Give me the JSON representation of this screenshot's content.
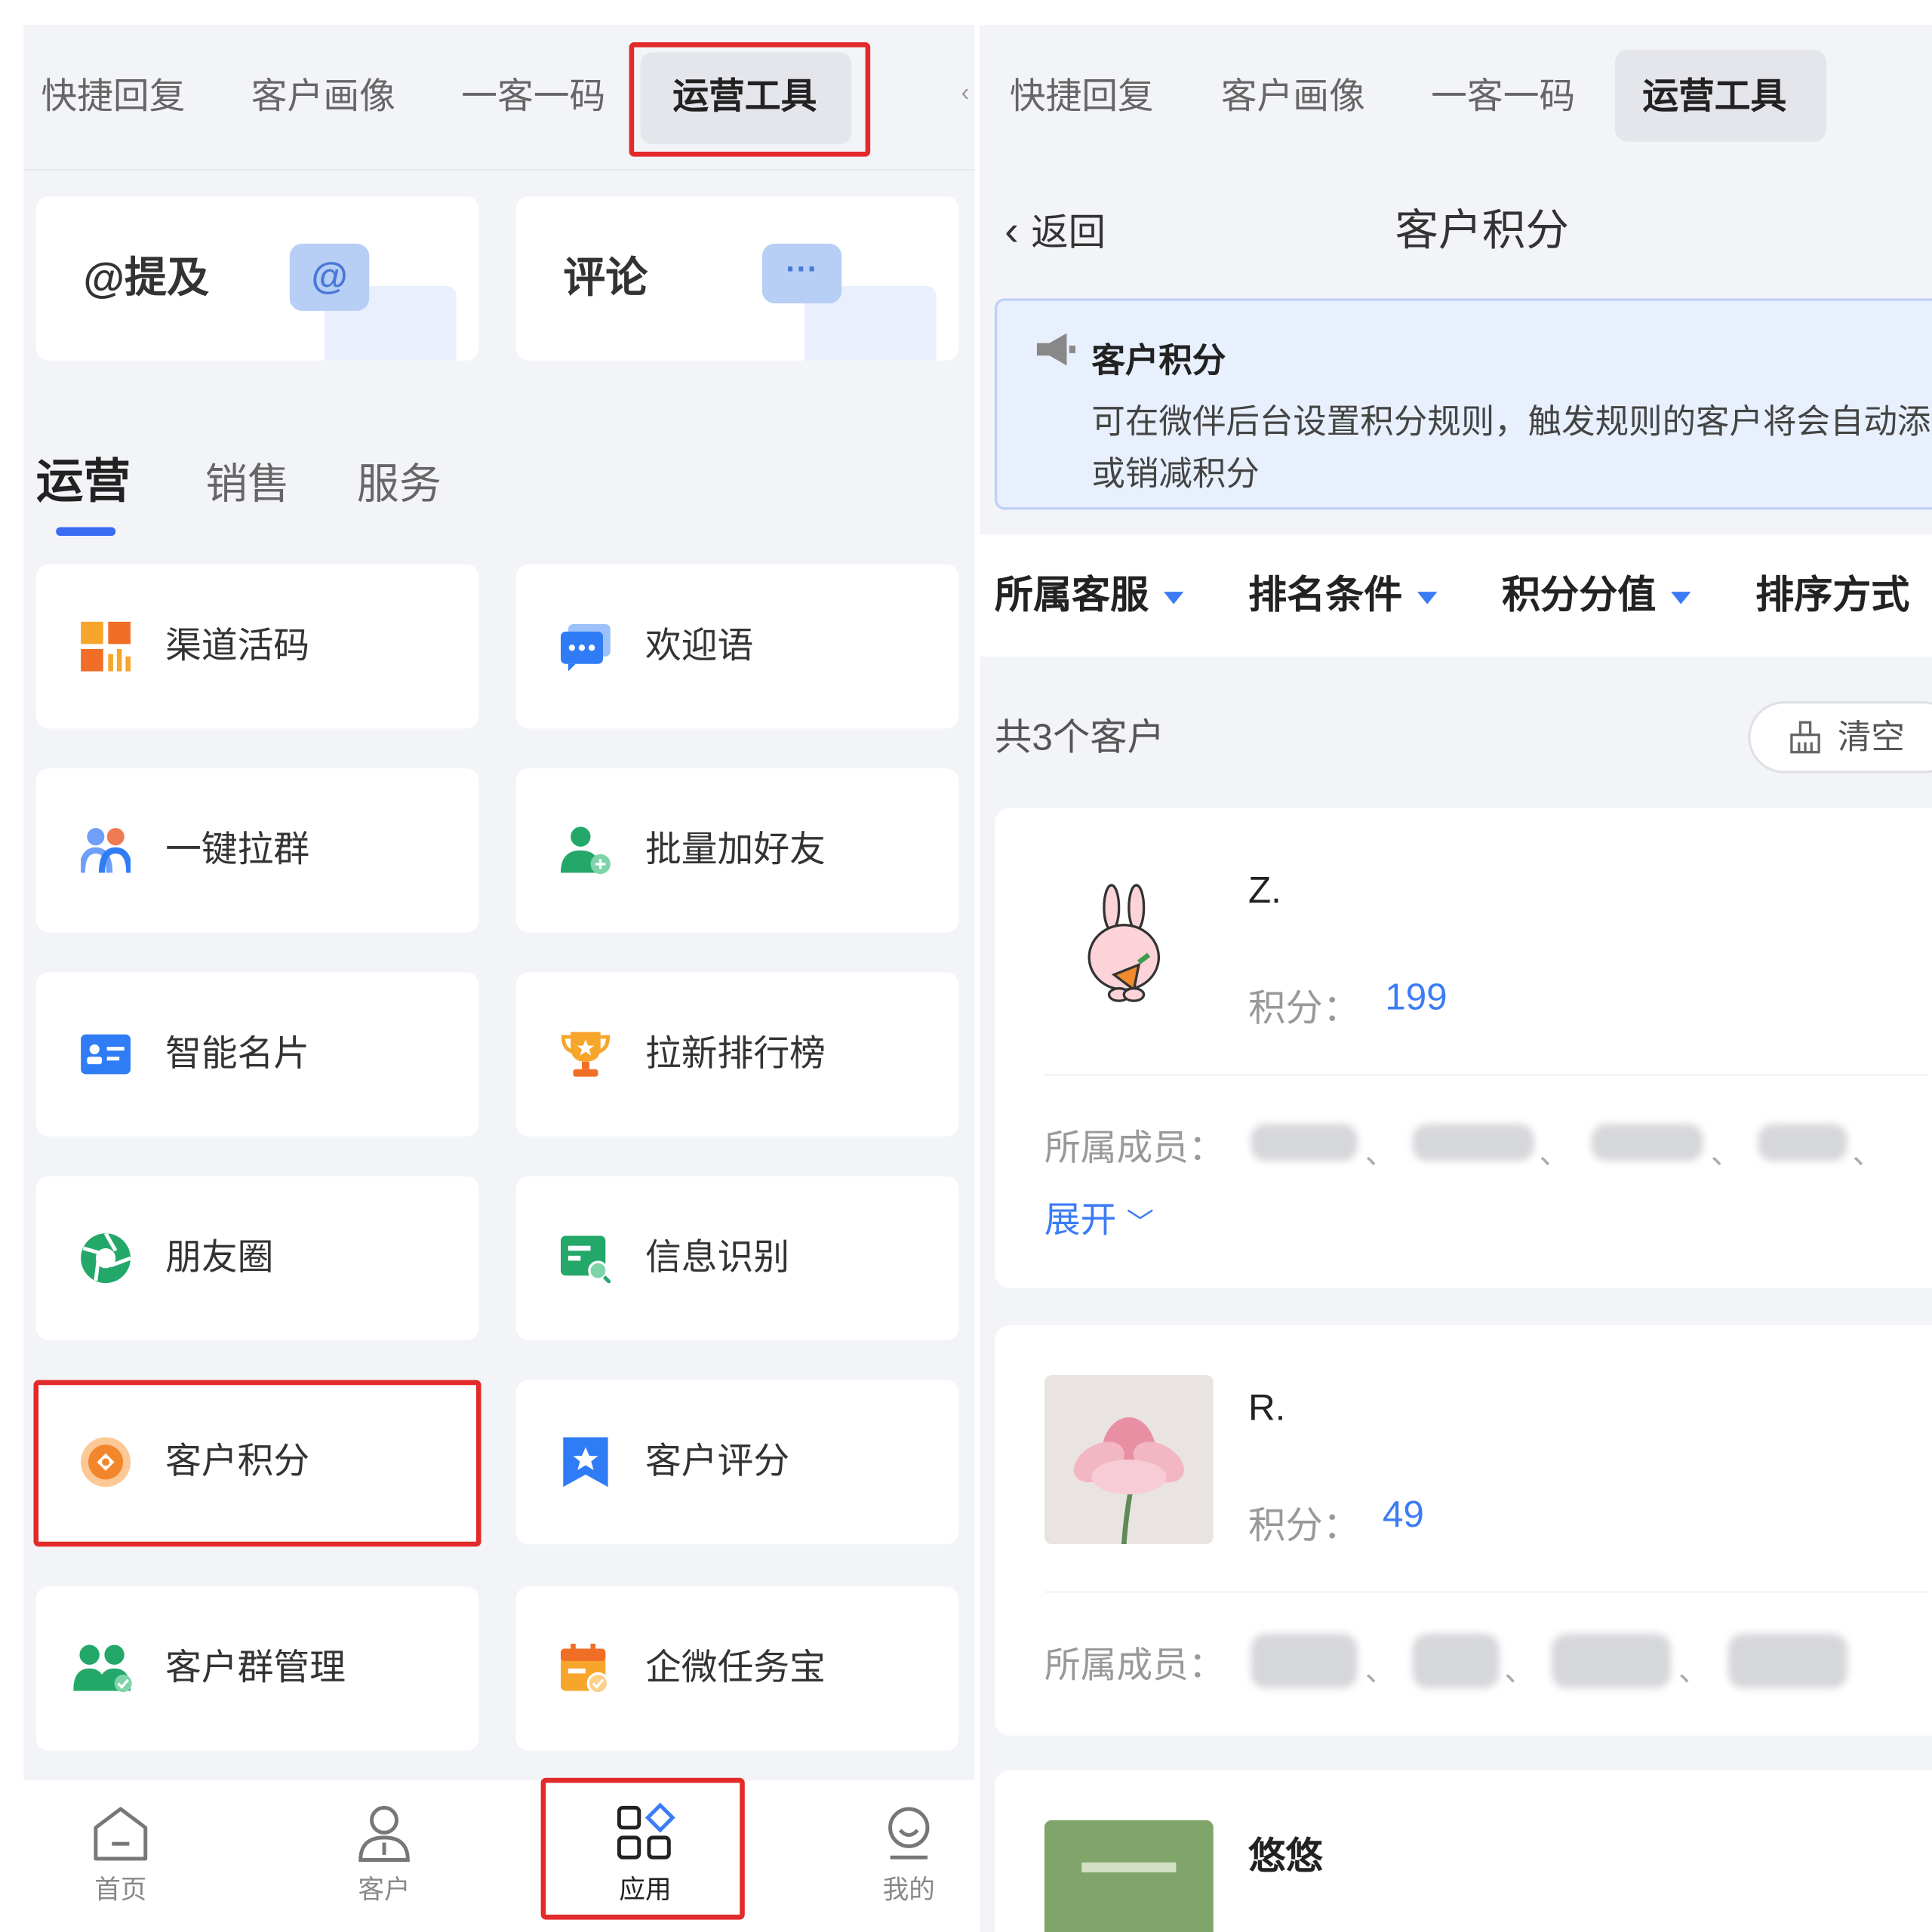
{
  "left": {
    "tabs": [
      "快捷回复",
      "客户画像",
      "一客一码",
      "运营工具"
    ],
    "big_cards": [
      {
        "label": "@提及",
        "badge": "@"
      },
      {
        "label": "评论",
        "badge": "···"
      }
    ],
    "segments": [
      "运营",
      "销售",
      "服务"
    ],
    "tools": [
      {
        "label": "渠道活码",
        "icon": "qrcode-grid-icon"
      },
      {
        "label": "欢迎语",
        "icon": "chat-bubble-icon"
      },
      {
        "label": "一键拉群",
        "icon": "users-icon"
      },
      {
        "label": "批量加好友",
        "icon": "add-friend-icon"
      },
      {
        "label": "智能名片",
        "icon": "id-card-icon"
      },
      {
        "label": "拉新排行榜",
        "icon": "trophy-icon"
      },
      {
        "label": "朋友圈",
        "icon": "aperture-icon"
      },
      {
        "label": "信息识别",
        "icon": "scan-card-icon"
      },
      {
        "label": "客户积分",
        "icon": "coin-icon"
      },
      {
        "label": "客户评分",
        "icon": "star-bookmark-icon"
      },
      {
        "label": "客户群管理",
        "icon": "group-icon"
      },
      {
        "label": "企微任务宝",
        "icon": "task-calendar-icon"
      }
    ],
    "nav": [
      {
        "label": "首页",
        "icon": "home-icon"
      },
      {
        "label": "客户",
        "icon": "person-icon"
      },
      {
        "label": "应用",
        "icon": "apps-icon"
      },
      {
        "label": "我的",
        "icon": "profile-icon"
      }
    ]
  },
  "right": {
    "tabs": [
      "快捷回复",
      "客户画像",
      "一客一码",
      "运营工具"
    ],
    "back_label": "返回",
    "page_title": "客户积分",
    "notice": {
      "title": "客户积分",
      "text": "可在微伴后台设置积分规则，触发规则的客户将会自动添加或销减积分"
    },
    "filters": [
      "所属客服",
      "排名条件",
      "积分分值",
      "排序方式"
    ],
    "count_text": "共3个客户",
    "clear_label": "清空",
    "points_label": "积分：",
    "members_label": "所属成员：",
    "expand_label": "展开",
    "customers": [
      {
        "name": "Z.",
        "points": "199"
      },
      {
        "name": "R.",
        "points": "49"
      },
      {
        "name": "悠悠"
      }
    ],
    "colors": {
      "accent": "#3b7cf5",
      "highlight": "#e32a2a"
    }
  }
}
